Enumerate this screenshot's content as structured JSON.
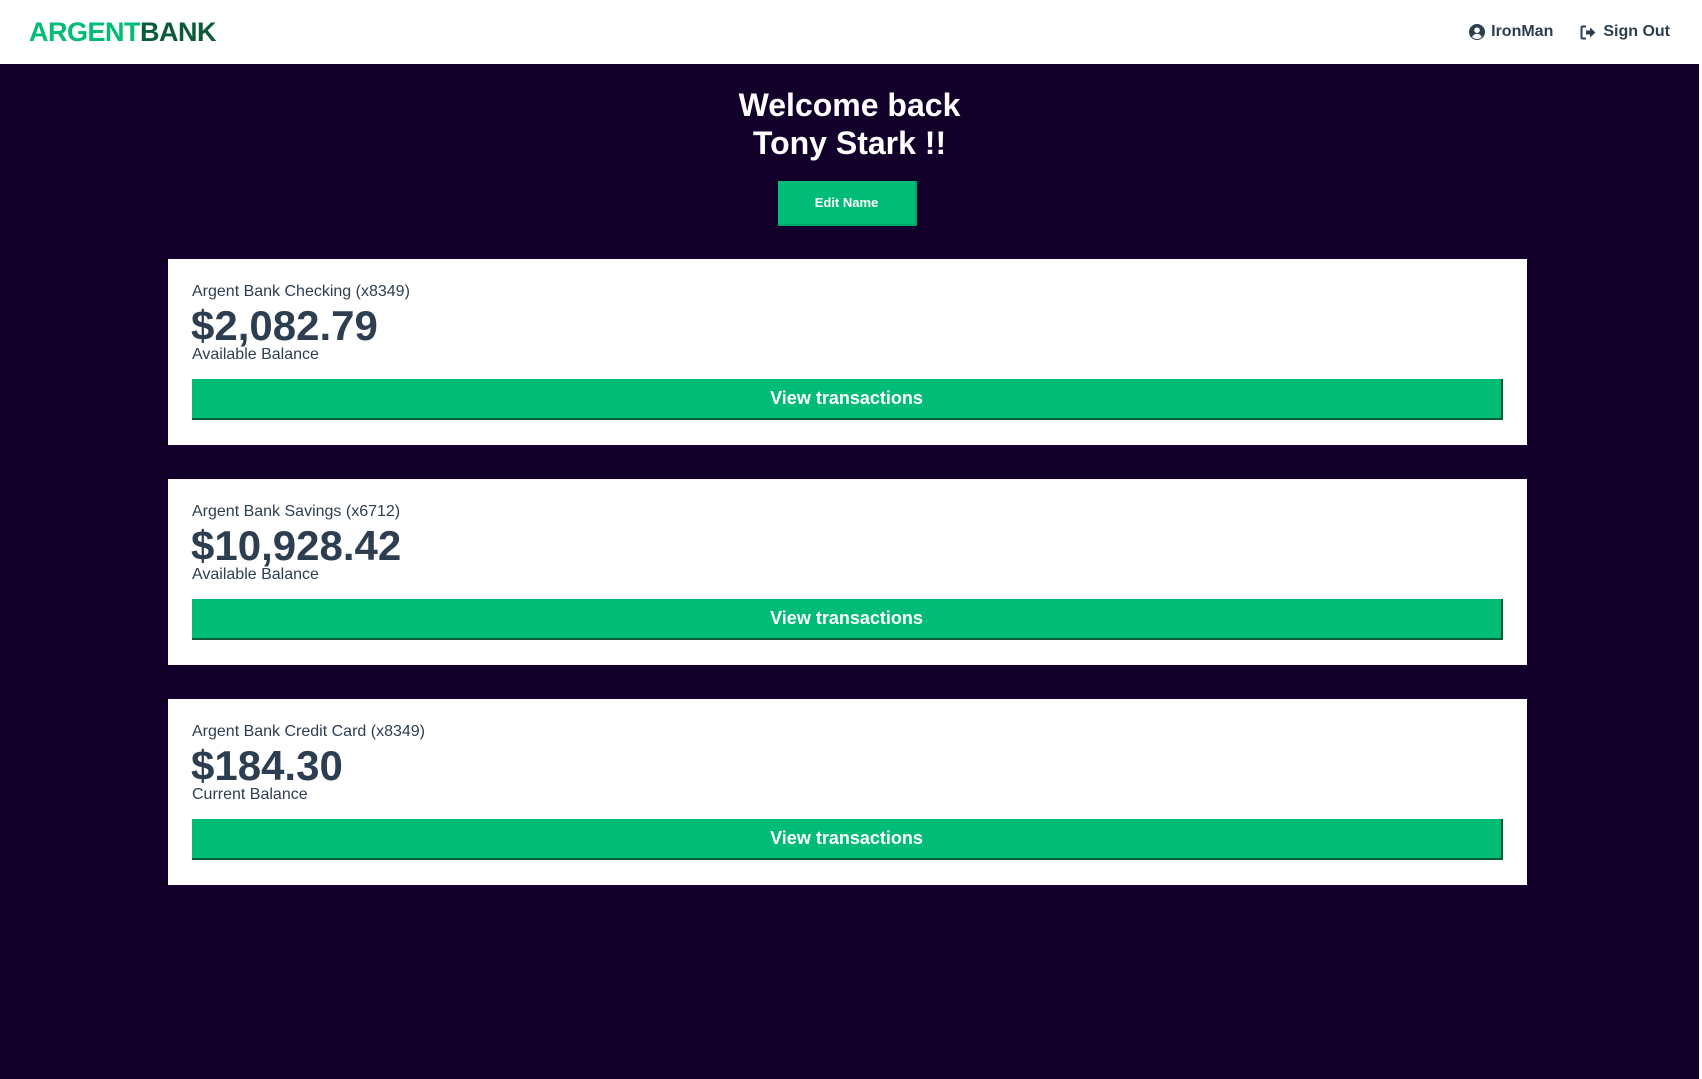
{
  "header": {
    "logo_part1": "ARGENT",
    "logo_part2": "BANK",
    "user_name": "IronMan",
    "user_icon": "user-circle-icon",
    "sign_out_label": "Sign Out",
    "sign_out_icon": "sign-out-icon"
  },
  "welcome": {
    "line1": "Welcome back",
    "line2": "Tony Stark !!",
    "edit_button": "Edit Name"
  },
  "accounts": [
    {
      "title": "Argent Bank Checking (x8349)",
      "amount": "$2,082.79",
      "description": "Available Balance",
      "button": "View transactions"
    },
    {
      "title": "Argent Bank Savings (x6712)",
      "amount": "$10,928.42",
      "description": "Available Balance",
      "button": "View transactions"
    },
    {
      "title": "Argent Bank Credit Card (x8349)",
      "amount": "$184.30",
      "description": "Current Balance",
      "button": "View transactions"
    }
  ],
  "colors": {
    "brand_green": "#00bc77",
    "brand_dark_green": "#0b5b38",
    "background_dark": "#12002b",
    "text_dark": "#2c3e50"
  }
}
